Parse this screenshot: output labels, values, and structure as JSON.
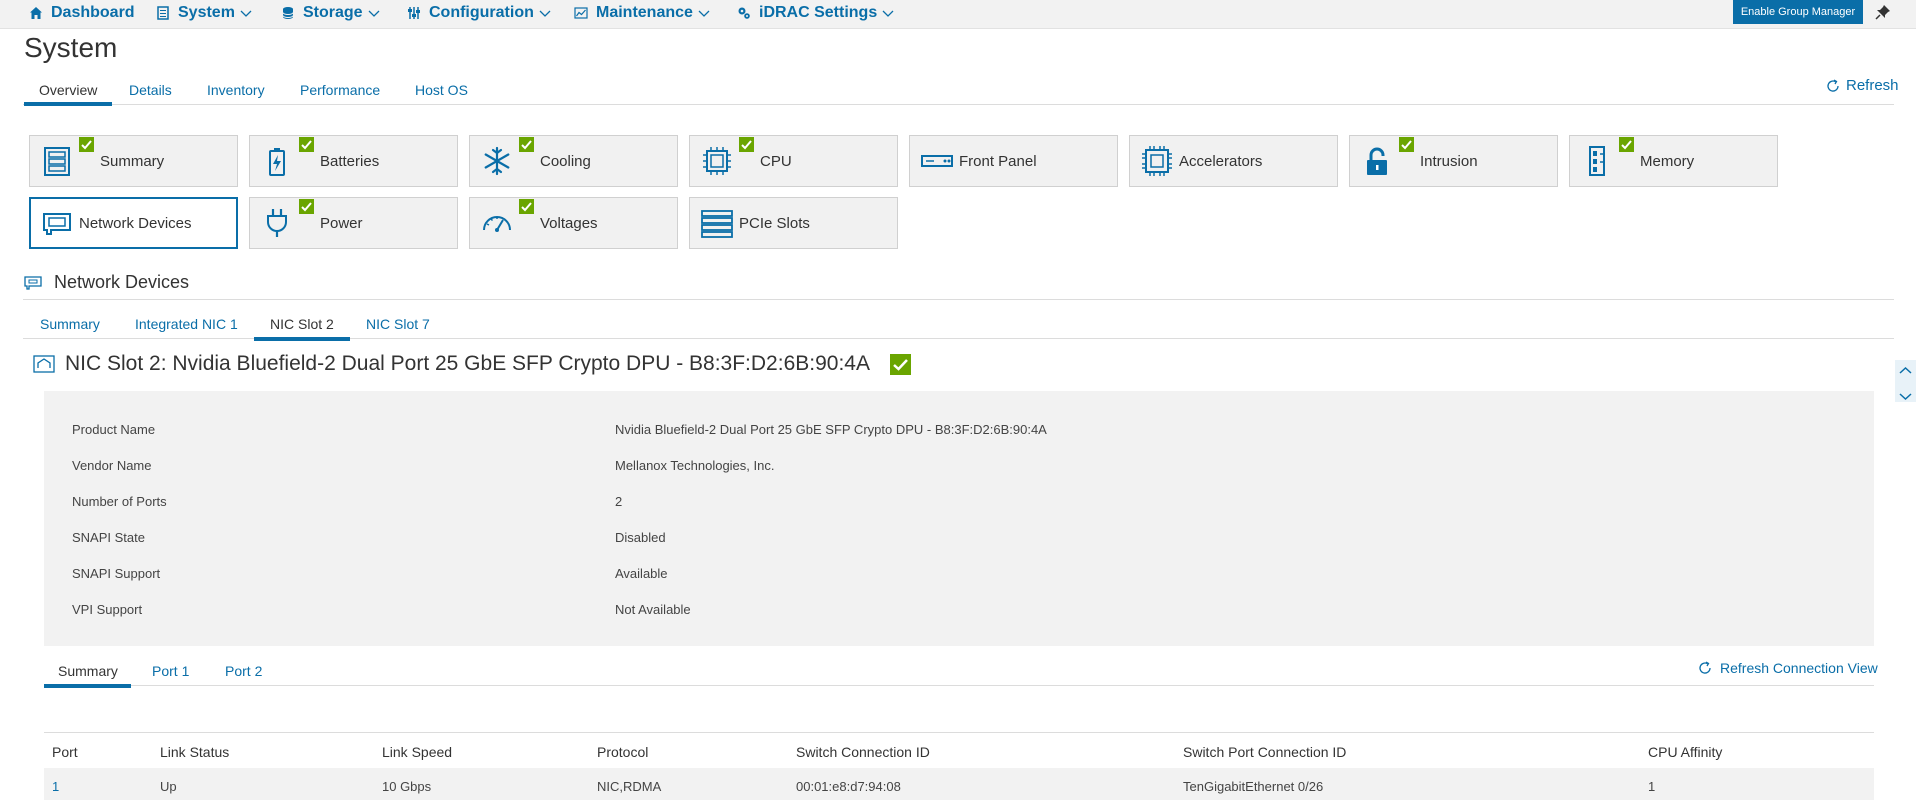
{
  "nav": {
    "items": [
      {
        "label": "Dashboard",
        "icon": "home-icon"
      },
      {
        "label": "System",
        "icon": "server-icon"
      },
      {
        "label": "Storage",
        "icon": "database-icon"
      },
      {
        "label": "Configuration",
        "icon": "sliders-icon"
      },
      {
        "label": "Maintenance",
        "icon": "chart-icon"
      },
      {
        "label": "iDRAC Settings",
        "icon": "gears-icon"
      }
    ],
    "enable_group_manager": "Enable Group Manager"
  },
  "page": {
    "title": "System",
    "tabs": [
      "Overview",
      "Details",
      "Inventory",
      "Performance",
      "Host OS"
    ],
    "active_tab": "Overview",
    "refresh_label": "Refresh"
  },
  "tiles": [
    {
      "label": "Summary",
      "icon": "summary-icon",
      "status": "ok"
    },
    {
      "label": "Batteries",
      "icon": "battery-icon",
      "status": "ok"
    },
    {
      "label": "Cooling",
      "icon": "snowflake-icon",
      "status": "ok"
    },
    {
      "label": "CPU",
      "icon": "cpu-icon",
      "status": "ok"
    },
    {
      "label": "Front Panel",
      "icon": "front-panel-icon",
      "status": ""
    },
    {
      "label": "Accelerators",
      "icon": "accelerator-icon",
      "status": ""
    },
    {
      "label": "Intrusion",
      "icon": "lock-icon",
      "status": "ok"
    },
    {
      "label": "Memory",
      "icon": "memory-icon",
      "status": "ok"
    },
    {
      "label": "Network Devices",
      "icon": "network-card-icon",
      "status": "",
      "active": true
    },
    {
      "label": "Power",
      "icon": "power-plug-icon",
      "status": "ok"
    },
    {
      "label": "Voltages",
      "icon": "gauge-icon",
      "status": "ok"
    },
    {
      "label": "PCIe Slots",
      "icon": "pcie-icon",
      "status": ""
    }
  ],
  "section": {
    "title": "Network Devices",
    "sub_tabs": [
      "Summary",
      "Integrated NIC 1",
      "NIC Slot 2",
      "NIC Slot 7"
    ],
    "active_sub_tab": "NIC Slot 2"
  },
  "device": {
    "title": "NIC Slot 2: Nvidia Bluefield-2 Dual Port 25 GbE SFP Crypto DPU - B8:3F:D2:6B:90:4A",
    "status": "ok",
    "properties": [
      {
        "key": "Product Name",
        "value": "Nvidia Bluefield-2 Dual Port 25 GbE SFP Crypto DPU - B8:3F:D2:6B:90:4A"
      },
      {
        "key": "Vendor Name",
        "value": "Mellanox Technologies, Inc."
      },
      {
        "key": "Number of Ports",
        "value": "2"
      },
      {
        "key": "SNAPI State",
        "value": "Disabled"
      },
      {
        "key": "SNAPI Support",
        "value": "Available"
      },
      {
        "key": "VPI Support",
        "value": "Not Available"
      }
    ]
  },
  "ports": {
    "tabs": [
      "Summary",
      "Port 1",
      "Port 2"
    ],
    "active_tab": "Summary",
    "refresh_connection_label": "Refresh Connection View",
    "columns": [
      "Port",
      "Link Status",
      "Link Speed",
      "Protocol",
      "Switch Connection ID",
      "Switch Port Connection ID",
      "CPU Affinity"
    ],
    "rows": [
      [
        "1",
        "Up",
        "10 Gbps",
        "NIC,RDMA",
        "00:01:e8:d7:94:08",
        "TenGigabitEthernet 0/26",
        "1"
      ]
    ]
  },
  "colors": {
    "accent": "#0a6ea8",
    "ok": "#6aa500",
    "panel": "#f2f2f2"
  }
}
